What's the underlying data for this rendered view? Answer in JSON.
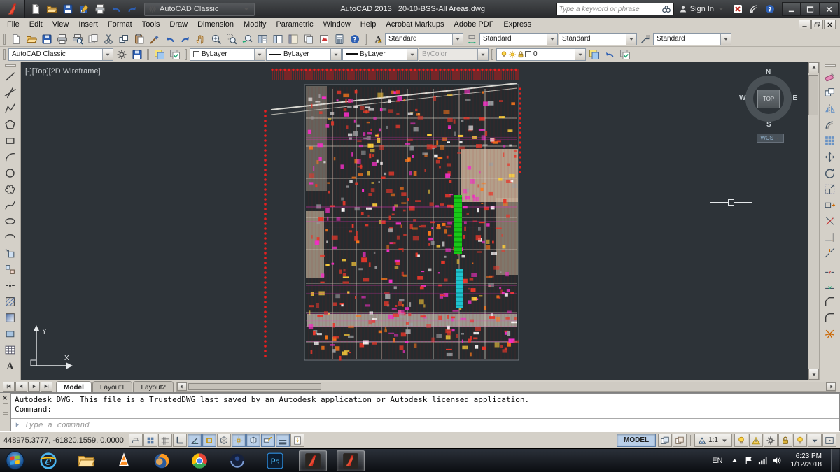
{
  "colors": {
    "canvas_bg": "#2d3338",
    "ui_gray": "#d4d0c8",
    "titlebar_bg": "#3a3d40",
    "autocad_red": "#c0281e",
    "toggle_active_blue": "#b9cfe8",
    "plan_red": "#e8382b",
    "plan_magenta": "#f230c8",
    "plan_green": "#17c917",
    "plan_cyan": "#1ec3ce"
  },
  "titlebar": {
    "qat_icons": [
      "qnew",
      "open",
      "save",
      "save-as",
      "plot",
      "undo",
      "redo"
    ],
    "workspace": "AutoCAD Classic",
    "title": "AutoCAD 2013   20-10-BSS-All Areas.dwg",
    "search_placeholder": "Type a keyword or phrase",
    "sign_in": "Sign In",
    "right_icons": [
      "exchange-apps",
      "communication-center",
      "help"
    ],
    "window_controls": [
      "minimize",
      "maximize",
      "close"
    ]
  },
  "menubar": {
    "items": [
      "File",
      "Edit",
      "View",
      "Insert",
      "Format",
      "Tools",
      "Draw",
      "Dimension",
      "Modify",
      "Parametric",
      "Window",
      "Help",
      "Acrobat Markups",
      "Adobe PDF",
      "Express"
    ],
    "mdi_controls": [
      "mdi-minimize",
      "mdi-restore",
      "mdi-close"
    ]
  },
  "toolbars": {
    "standard_icons": [
      "qnew",
      "open",
      "save",
      "plot",
      "plot-preview",
      "publish",
      "cut",
      "copy-clip",
      "paste",
      "match-properties",
      "undo",
      "redo",
      "pan",
      "zoom-realtime",
      "zoom-window",
      "zoom-previous",
      "properties",
      "designcenter",
      "tool-palettes",
      "sheet-set-manager",
      "markup-set-manager",
      "quickcalc",
      "help"
    ],
    "styles": {
      "text_style": "Standard",
      "dim_style": "Standard",
      "table_style": "Standard",
      "mleader_style": "Standard"
    },
    "workspace_value": "AutoCAD Classic",
    "workspace_icons": [
      "gear",
      "save-workspace"
    ],
    "layer_icons": [
      "layer-properties",
      "layer-states"
    ],
    "properties": {
      "color": "ByLayer",
      "linetype": "ByLayer",
      "lineweight": "ByLayer",
      "plot_style": "ByColor"
    },
    "layers": {
      "current": "0",
      "right_icons": [
        "make-object-layer-current",
        "layer-previous",
        "layer-match"
      ]
    }
  },
  "draw_tools": [
    "line",
    "construction-line",
    "polyline",
    "polygon",
    "rectangle",
    "arc",
    "circle",
    "revision-cloud",
    "spline",
    "ellipse",
    "ellipse-arc",
    "insert-block",
    "make-block",
    "point",
    "hatch",
    "gradient",
    "region",
    "table",
    "multiline-text"
  ],
  "modify_tools": [
    "erase",
    "copy",
    "mirror",
    "offset",
    "array",
    "move",
    "rotate",
    "scale",
    "stretch",
    "trim",
    "extend",
    "break-at-point",
    "break",
    "join",
    "chamfer",
    "fillet",
    "explode"
  ],
  "canvas": {
    "viewport_label": "[-][Top][2D Wireframe]",
    "viewcube": {
      "north": "N",
      "south": "S",
      "west": "W",
      "east": "E",
      "face": "TOP",
      "wcs_label": "WCS"
    }
  },
  "layout_bar": {
    "tabs": [
      {
        "name": "Model",
        "active": true
      },
      {
        "name": "Layout1"
      },
      {
        "name": "Layout2"
      }
    ]
  },
  "command_window": {
    "line1": "Autodesk DWG.  This file is a TrustedDWG last saved by an Autodesk application or Autodesk licensed application.",
    "line2": "Command:",
    "placeholder": "Type a command"
  },
  "statusbar": {
    "coordinates": "448975.3777, -61820.1559, 0.0000",
    "toggles": [
      {
        "name": "infer-constraints",
        "active": false
      },
      {
        "name": "snap",
        "active": false
      },
      {
        "name": "grid",
        "active": false
      },
      {
        "name": "ortho",
        "active": false
      },
      {
        "name": "polar",
        "active": true
      },
      {
        "name": "osnap",
        "active": true
      },
      {
        "name": "3d-osnap",
        "active": false
      },
      {
        "name": "otrack",
        "active": true
      },
      {
        "name": "ducs",
        "active": true
      },
      {
        "name": "dyn",
        "active": true
      },
      {
        "name": "lwt",
        "active": true
      },
      {
        "name": "qp",
        "active": false
      }
    ],
    "model_label": "MODEL",
    "right_icons_a": [
      "quick-view-layouts",
      "quick-view-drawings"
    ],
    "annotation_scale": "1:1",
    "right_icons_b": [
      "annotation-visibility",
      "autoscale",
      "workspace-switching",
      "toolbar-lock",
      "isolate-objects",
      "status-menu",
      "clean-screen"
    ]
  },
  "taskbar": {
    "language": "EN",
    "time": "6:23 PM",
    "date": "1/12/2018",
    "apps": [
      {
        "name": "internet-explorer"
      },
      {
        "name": "file-explorer"
      },
      {
        "name": "media-player"
      },
      {
        "name": "firefox"
      },
      {
        "name": "chrome"
      },
      {
        "name": "eclipse"
      },
      {
        "name": "photoshop"
      },
      {
        "name": "autocad",
        "active": true
      },
      {
        "name": "autocad-2",
        "active": true
      }
    ],
    "tray_icons": [
      "hidden-icons",
      "action-center",
      "network",
      "volume"
    ]
  }
}
